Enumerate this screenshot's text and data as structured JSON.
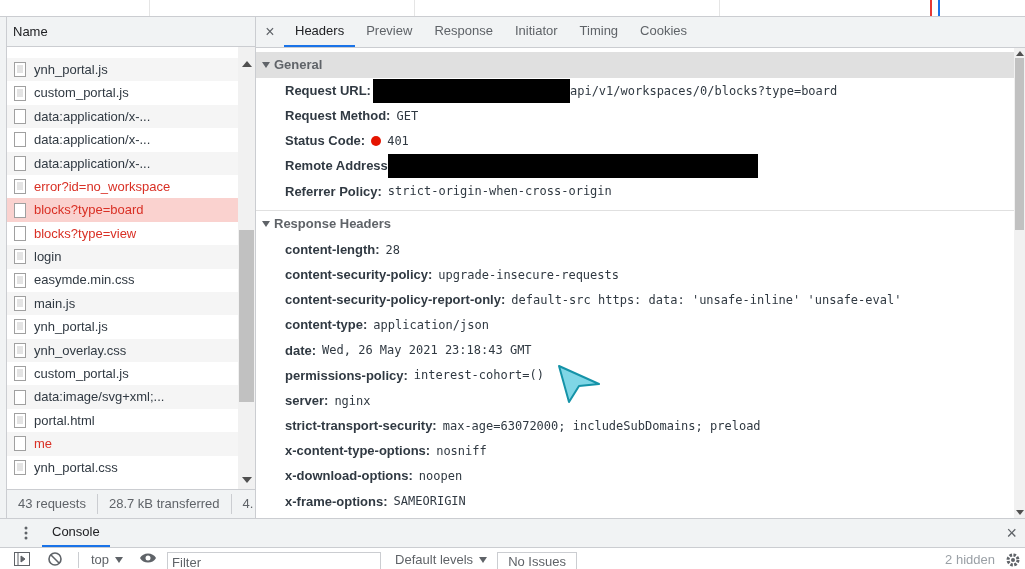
{
  "requests_panel": {
    "column_header": "Name",
    "rows": [
      {
        "name": "ynh_portal.js",
        "kind": "doc",
        "error": false,
        "selected": false
      },
      {
        "name": "custom_portal.js",
        "kind": "doc",
        "error": false,
        "selected": false
      },
      {
        "name": "data:application/x-...",
        "kind": "blank",
        "error": false,
        "selected": false
      },
      {
        "name": "data:application/x-...",
        "kind": "blank",
        "error": false,
        "selected": false
      },
      {
        "name": "data:application/x-...",
        "kind": "blank",
        "error": false,
        "selected": false
      },
      {
        "name": "error?id=no_workspace",
        "kind": "doc",
        "error": true,
        "selected": false
      },
      {
        "name": "blocks?type=board",
        "kind": "blank",
        "error": true,
        "selected": true
      },
      {
        "name": "blocks?type=view",
        "kind": "blank",
        "error": true,
        "selected": false
      },
      {
        "name": "login",
        "kind": "doc",
        "error": false,
        "selected": false
      },
      {
        "name": "easymde.min.css",
        "kind": "doc",
        "error": false,
        "selected": false
      },
      {
        "name": "main.js",
        "kind": "doc",
        "error": false,
        "selected": false
      },
      {
        "name": "ynh_portal.js",
        "kind": "doc",
        "error": false,
        "selected": false
      },
      {
        "name": "ynh_overlay.css",
        "kind": "doc",
        "error": false,
        "selected": false
      },
      {
        "name": "custom_portal.js",
        "kind": "doc",
        "error": false,
        "selected": false
      },
      {
        "name": "data:image/svg+xml;...",
        "kind": "blank",
        "error": false,
        "selected": false
      },
      {
        "name": "portal.html",
        "kind": "doc",
        "error": false,
        "selected": false
      },
      {
        "name": "me",
        "kind": "blank",
        "error": true,
        "selected": false
      },
      {
        "name": "ynh_portal.css",
        "kind": "doc",
        "error": false,
        "selected": false
      }
    ],
    "summary": [
      "43 requests",
      "28.7 kB transferred",
      "4."
    ]
  },
  "details": {
    "tabs": [
      {
        "label": "Headers",
        "selected": true
      },
      {
        "label": "Preview",
        "selected": false
      },
      {
        "label": "Response",
        "selected": false
      },
      {
        "label": "Initiator",
        "selected": false
      },
      {
        "label": "Timing",
        "selected": false
      },
      {
        "label": "Cookies",
        "selected": false
      }
    ],
    "close": "×",
    "sections": [
      {
        "title": "General",
        "expanded": true,
        "shaded": true,
        "rows": [
          {
            "label": "Request URL:",
            "value": "api/v1/workspaces/0/blocks?type=board",
            "redacted": true
          },
          {
            "label": "Request Method:",
            "value": "GET"
          },
          {
            "label": "Status Code:",
            "value": "401",
            "color": "#e51400"
          },
          {
            "label": "Remote Address",
            "redacted": true
          },
          {
            "label": "Referrer Policy:",
            "value": "strict-origin-when-cross-origin"
          }
        ]
      },
      {
        "title": "Response Headers",
        "expanded": true,
        "shaded": false,
        "rows": [
          {
            "label": "content-length:",
            "value": "28"
          },
          {
            "label": "content-security-policy:",
            "value": "upgrade-insecure-requests"
          },
          {
            "label": "content-security-policy-report-only:",
            "value": "default-src https: data: 'unsafe-inline' 'unsafe-eval'"
          },
          {
            "label": "content-type:",
            "value": "application/json"
          },
          {
            "label": "date:",
            "value": "Wed, 26 May 2021 23:18:43 GMT"
          },
          {
            "label": "permissions-policy:",
            "value": "interest-cohort=()"
          },
          {
            "label": "server:",
            "value": "nginx"
          },
          {
            "label": "strict-transport-security:",
            "value": "max-age=63072000; includeSubDomains; preload"
          },
          {
            "label": "x-content-type-options:",
            "value": "nosniff"
          },
          {
            "label": "x-download-options:",
            "value": "noopen"
          },
          {
            "label": "x-frame-options:",
            "value": "SAMEORIGIN"
          }
        ]
      }
    ]
  },
  "drawer": {
    "tab": "Console",
    "close": "×",
    "context": "top",
    "filter_placeholder": "Filter",
    "levels": "Default levels",
    "issues": "No Issues",
    "hidden": "2 hidden"
  }
}
